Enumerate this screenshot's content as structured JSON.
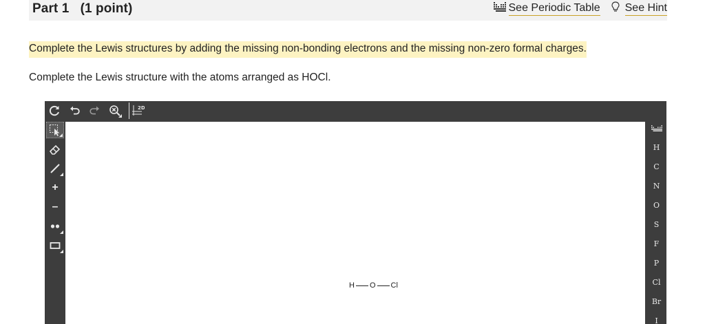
{
  "header": {
    "part_label": "Part 1",
    "points_label": "(1 point)",
    "periodic_table_link": "See Periodic Table",
    "hint_link": "See Hint"
  },
  "question": {
    "instruction": "Complete the Lewis structures by adding the missing non-bonding electrons and the missing non-zero formal charges.",
    "sub_instruction": "Complete the Lewis structure with the atoms arranged as HOCl."
  },
  "editor": {
    "top_tools": [
      "reset-icon",
      "undo-icon",
      "redo-icon",
      "zoom-icon",
      "2d-clean-icon"
    ],
    "top_tool_text": {
      "clean2d": "2D"
    },
    "left_tools": [
      "select-icon",
      "eraser-icon",
      "bond-icon",
      "charge-plus-icon",
      "charge-minus-icon",
      "lone-pair-icon",
      "rectangle-icon"
    ],
    "left_tool_text": {
      "plus": "+",
      "minus": "–"
    },
    "elements": [
      "H",
      "C",
      "N",
      "O",
      "S",
      "F",
      "P",
      "Cl",
      "Br",
      "I"
    ],
    "molecule": {
      "atom1": "H",
      "atom2": "O",
      "atom3": "Cl"
    }
  },
  "colors": {
    "highlight": "#fdf3c2",
    "toolbar_bg": "#3d3d3d",
    "header_bg": "#f2f2f2",
    "link_underline": "#c9a227"
  }
}
